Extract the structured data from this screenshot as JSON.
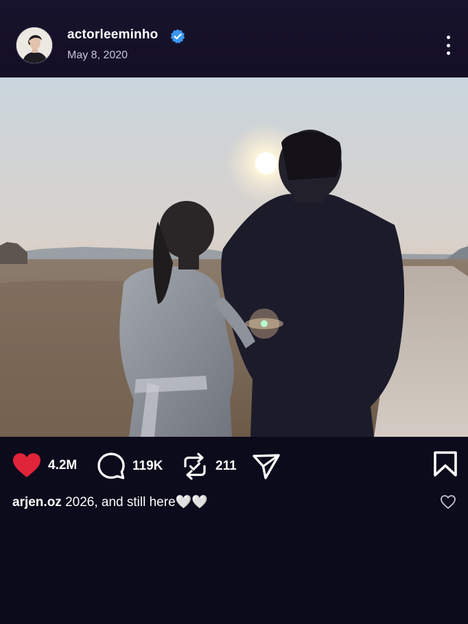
{
  "post": {
    "username": "actorleeminho",
    "date": "May 8, 2020",
    "verified": true
  },
  "actions": {
    "likes": "4.2M",
    "comments": "119K",
    "reposts": "211"
  },
  "caption": {
    "user": "arjen.oz",
    "text": " 2026, and still here🤍🤍"
  },
  "icons": {
    "more": "more-vertical-icon",
    "like": "heart-filled-icon",
    "comment": "comment-bubble-icon",
    "repost": "repost-icon",
    "share": "send-icon",
    "bookmark": "bookmark-icon",
    "caption_like": "heart-outline-icon"
  },
  "colors": {
    "background": "#0b0b1c",
    "header": "#17132c",
    "like_red": "#e0243a",
    "verified_blue": "#3b97f0"
  }
}
